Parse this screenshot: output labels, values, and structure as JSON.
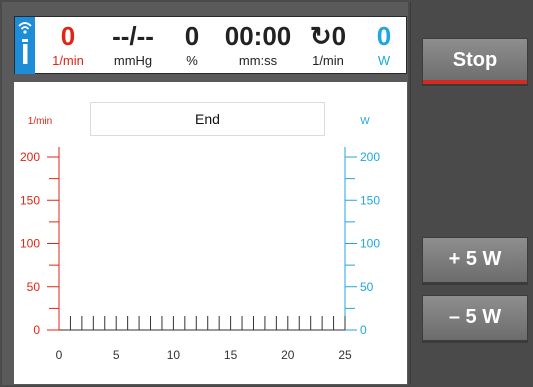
{
  "header": {
    "metrics": [
      {
        "value": "0",
        "unit": "1/min",
        "color": "#e22414"
      },
      {
        "value": "--/--",
        "unit": "mmHg",
        "color": "#222222"
      },
      {
        "value": "0",
        "unit": "%",
        "color": "#222222"
      },
      {
        "value": "00:00",
        "unit": "mm:ss",
        "color": "#222222"
      },
      {
        "value": "↻0",
        "unit": "1/min",
        "color": "#222222"
      },
      {
        "value": "0",
        "unit": "W",
        "color": "#1ea7e1"
      }
    ],
    "info_icon": "info-wifi-icon"
  },
  "plot": {
    "status_text": "End"
  },
  "chart_data": {
    "type": "line",
    "title": "",
    "x": [],
    "series": [],
    "xlim": [
      0,
      25
    ],
    "x_ticks": [
      "0",
      "5",
      "10",
      "15",
      "20",
      "25"
    ],
    "left_axis": {
      "label": "1/min",
      "ylim": [
        0,
        200
      ],
      "ticks": [
        "0",
        "50",
        "100",
        "150",
        "200"
      ],
      "color": "#e22414"
    },
    "right_axis": {
      "label": "W",
      "ylim": [
        0,
        200
      ],
      "ticks": [
        "0",
        "50",
        "100",
        "150",
        "200"
      ],
      "color": "#1ea7e1"
    }
  },
  "sidebar": {
    "stop_label": "Stop",
    "plus_label": "+ 5 W",
    "minus_label": "– 5 W"
  }
}
